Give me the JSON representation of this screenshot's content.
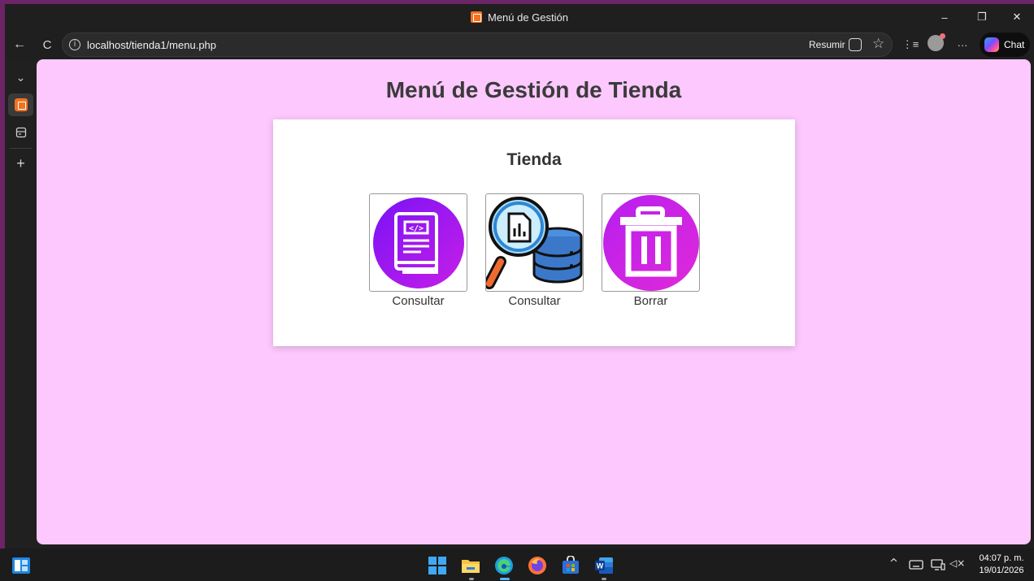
{
  "window": {
    "title": "Menú de Gestión",
    "controls": {
      "minimize": "–",
      "restore": "❐",
      "close": "✕"
    }
  },
  "toolbar": {
    "back": "←",
    "reload": "C",
    "info": "i",
    "url": "localhost/tienda1/menu.php",
    "summarize_label": "Resumir",
    "favorite": "☆",
    "favorites_list": "⋮≡",
    "more": "···",
    "chat_label": "Chat"
  },
  "sidebar": {
    "collapse": "⌄",
    "add": "+"
  },
  "page": {
    "title": "Menú de Gestión de Tienda",
    "card_title": "Tienda",
    "options": [
      {
        "label": "Consultar",
        "icon": "code-book-icon"
      },
      {
        "label": "Consultar",
        "icon": "search-database-icon"
      },
      {
        "label": "Borrar",
        "icon": "trash-icon"
      }
    ]
  },
  "taskbar": {
    "apps": [
      "windows-start",
      "file-explorer",
      "edge",
      "firefox",
      "microsoft-store",
      "word"
    ],
    "tray": {
      "chevron": "^",
      "sound": "◁×"
    },
    "time": "04:07 p. m.",
    "date": "19/01/2026"
  },
  "colors": {
    "page_background": "#fcc8fd",
    "frame": "#6b2466",
    "accent_purple": "#a21bf0"
  }
}
